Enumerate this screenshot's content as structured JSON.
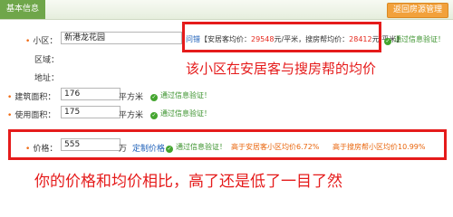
{
  "header": {
    "tab": "基本信息",
    "button": "返回房源管理"
  },
  "form": {
    "community": {
      "label": "小区：",
      "value": "新港龙花园"
    },
    "district": {
      "label": "区域："
    },
    "address": {
      "label": "地址："
    },
    "build_area": {
      "label": "建筑面积：",
      "value": "176",
      "unit": "平方米",
      "ok": "通过信息验证！"
    },
    "use_area": {
      "label": "使用面积：",
      "value": "175",
      "unit": "平方米",
      "ok": "通过信息验证！"
    },
    "price": {
      "label": "价格：",
      "value": "555",
      "unit": "万",
      "pricing_link": "定制价格",
      "ok": "通过信息验证！",
      "cmp1": "高于安居客小区均价6.72%",
      "cmp2": "高于搜房帮小区均价10.99%"
    }
  },
  "avg_price": {
    "prefix": "问错",
    "anjuke_label": "【安居客均价：",
    "anjuke_value": "29548",
    "unit1": "元/平米，",
    "soufang_label": "搜房帮均价：",
    "soufang_value": "28412",
    "unit2": "元/平米】",
    "ok": "通过信息验证！"
  },
  "annotations": {
    "avg": "该小区在安居客与搜房帮的均价",
    "compare": "你的价格和均价相比，高了还是低了一目了然"
  },
  "colors": {
    "accent_green": "#6fa64a",
    "button_orange": "#f2a13b",
    "annotation_red": "#e51b1b",
    "ok_green": "#38912a"
  }
}
